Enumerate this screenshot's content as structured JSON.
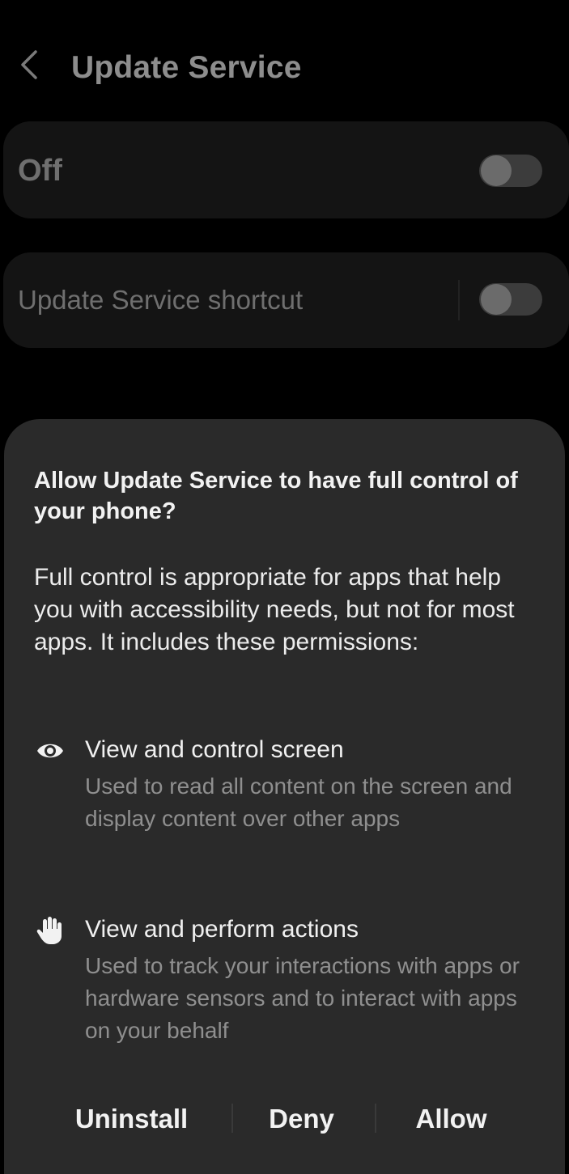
{
  "colors": {
    "background": "#000000",
    "card": "#141414",
    "dialog": "#2a2a2a",
    "dimmed_text": "#8d8d8d",
    "primary_text": "#f2f2f2",
    "secondary_text": "#8f8f8f"
  },
  "header": {
    "back_icon": "chevron-left-icon",
    "title": "Update Service"
  },
  "main_switch": {
    "label": "Off",
    "state": "off"
  },
  "shortcut_switch": {
    "label": "Update Service shortcut",
    "state": "off"
  },
  "dialog": {
    "title": "Allow Update Service to have full control of your phone?",
    "body": "Full control is appropriate for apps that help you with accessibility needs, but not for most apps. It includes these permissions:",
    "permissions": [
      {
        "icon": "eye-icon",
        "title": "View and control screen",
        "description": "Used to read all content on the screen and display content over other apps"
      },
      {
        "icon": "hand-icon",
        "title": "View and perform actions",
        "description": "Used to track your interactions with apps or hardware sensors and to interact with apps on your behalf"
      }
    ],
    "buttons": {
      "uninstall": "Uninstall",
      "deny": "Deny",
      "allow": "Allow"
    }
  }
}
